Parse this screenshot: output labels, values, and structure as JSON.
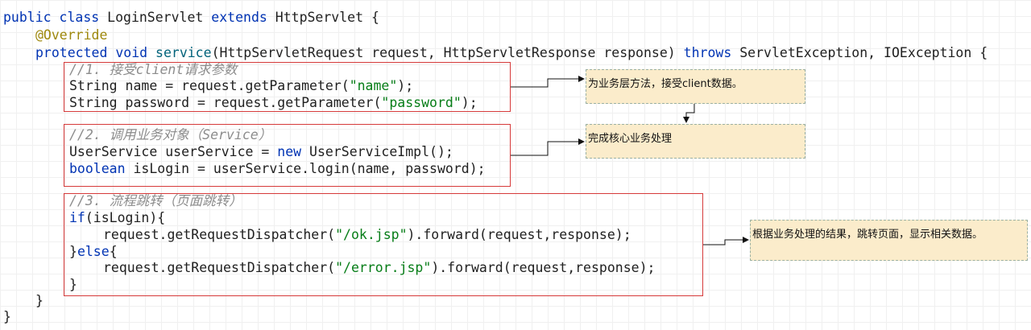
{
  "code": {
    "line1": {
      "kw1": "public class ",
      "name": "LoginServlet ",
      "kw2": "extends ",
      "parent": "HttpServlet {"
    },
    "line2": {
      "ann": "@Override"
    },
    "line3": {
      "kw": "protected void ",
      "fn": "service",
      "args": "(HttpServletRequest request, HttpServletResponse response) ",
      "throws": "throws ",
      "ex": "ServletException, IOException {"
    },
    "line4": {
      "cmt": "//1. 接受client请求参数"
    },
    "line5": {
      "pre": "String name = request.getParameter(",
      "str": "\"name\"",
      "post": ");"
    },
    "line6": {
      "pre": "String password = request.getParameter(",
      "str": "\"password\"",
      "post": ");"
    },
    "line7": {
      "cmt": "//2. 调用业务对象（Service）"
    },
    "line8": {
      "pre": "UserService userService = ",
      "kw": "new ",
      "post": "UserServiceImpl();"
    },
    "line9": {
      "kw": "boolean ",
      "post": "isLogin = userService.login(name, password);"
    },
    "line10": {
      "cmt": "//3. 流程跳转（页面跳转）"
    },
    "line11": {
      "kw": "if",
      "post": "(isLogin){"
    },
    "line12": {
      "pre": "request.getRequestDispatcher(",
      "str": "\"/ok.jsp\"",
      "post": ").forward(request,response);"
    },
    "line13": {
      "pre": "}",
      "kw": "else",
      "post": "{"
    },
    "line14": {
      "pre": "request.getRequestDispatcher(",
      "str": "\"/error.jsp\"",
      "post": ").forward(request,response);"
    },
    "line15": {
      "text": "}"
    },
    "line16": {
      "text": "}"
    },
    "line17": {
      "text": "}"
    }
  },
  "notes": {
    "note1": "为业务层方法，接受client数据。",
    "note2": "完成核心业务处理",
    "note3": "根据业务处理的结果，跳转页面，显示相关数据。"
  },
  "colors": {
    "keyword": "#0033b3",
    "annotation": "#9e880d",
    "string": "#067d17",
    "comment": "#8c8c8c",
    "box_border": "#d63a3a",
    "note_fill": "#fbeccb"
  }
}
